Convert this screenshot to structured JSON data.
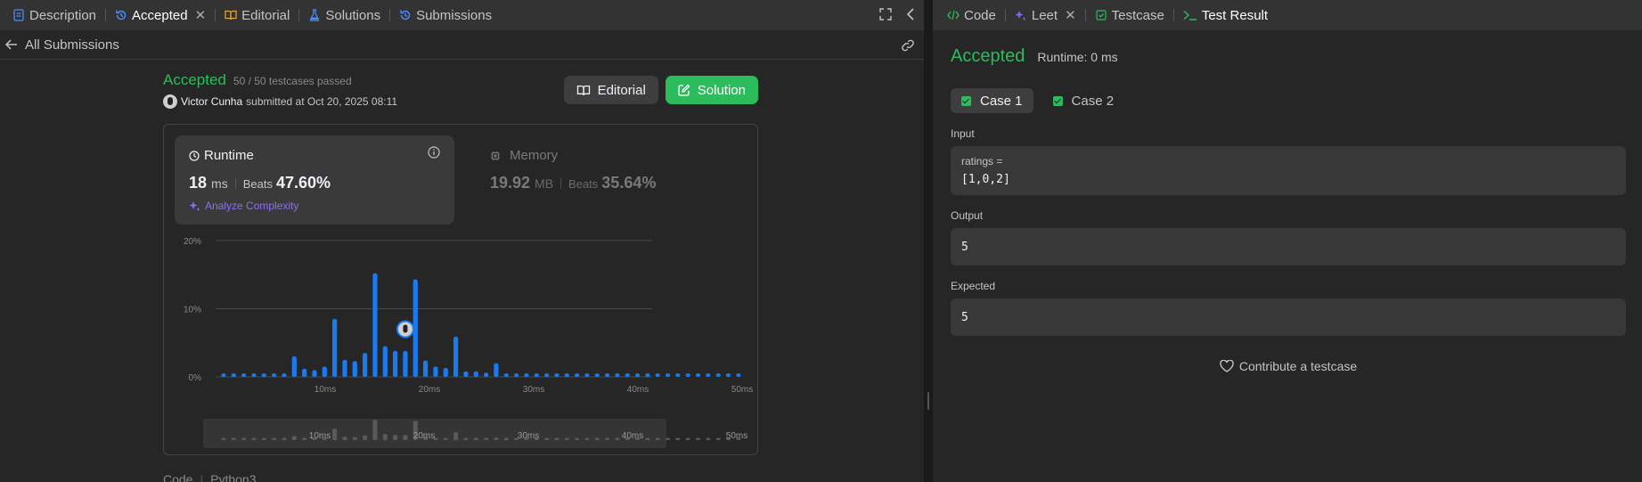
{
  "left_tabs": [
    {
      "label": "Description",
      "icon": "description-icon",
      "color": "#4a8cff"
    },
    {
      "label": "Accepted",
      "icon": "history-icon",
      "color": "#4a8cff",
      "active": true,
      "closable": true
    },
    {
      "label": "Editorial",
      "icon": "book-icon",
      "color": "#e8a835"
    },
    {
      "label": "Solutions",
      "icon": "flask-icon",
      "color": "#4a8cff"
    },
    {
      "label": "Submissions",
      "icon": "history-icon",
      "color": "#4a8cff"
    }
  ],
  "subbar": {
    "back_label": "All Submissions"
  },
  "submission": {
    "status": "Accepted",
    "testcases": "50 / 50 testcases passed",
    "user": "Victor Cunha",
    "submitted_text": "submitted at Oct 20, 2025 08:11",
    "editorial_btn": "Editorial",
    "solution_btn": "Solution"
  },
  "runtime": {
    "title": "Runtime",
    "value": "18",
    "unit": "ms",
    "beats_label": "Beats",
    "beats": "47.60%",
    "analyze": "Analyze Complexity"
  },
  "memory": {
    "title": "Memory",
    "value": "19.92",
    "unit": "MB",
    "beats_label": "Beats",
    "beats": "35.64%"
  },
  "chart_data": {
    "type": "bar",
    "y_ticks": [
      "20%",
      "10%",
      "0%"
    ],
    "ylim": [
      0,
      20
    ],
    "x_ticks": [
      "10ms",
      "20ms",
      "30ms",
      "40ms",
      "50ms"
    ],
    "x_tick_values": [
      10,
      20,
      30,
      40,
      50
    ],
    "x": [
      0,
      1,
      2,
      3,
      4,
      5,
      6,
      7,
      8,
      9,
      10,
      11,
      12,
      13,
      14,
      15,
      16,
      17,
      18,
      19,
      20,
      21,
      22,
      23,
      24,
      25,
      26,
      27,
      28,
      29,
      30,
      31,
      32,
      33,
      34,
      35,
      36,
      37,
      38,
      39,
      40,
      41,
      42,
      43,
      44,
      45,
      46,
      47,
      48,
      49,
      50,
      51
    ],
    "values": [
      0.5,
      0.5,
      0.5,
      0.5,
      0.5,
      0.5,
      0.5,
      3.0,
      1.2,
      1.0,
      1.5,
      8.5,
      2.5,
      2.3,
      3.5,
      15.2,
      4.5,
      3.8,
      3.8,
      14.3,
      2.4,
      1.5,
      1.3,
      5.9,
      0.8,
      0.8,
      0.6,
      2.0,
      0.5,
      0.5,
      0.5,
      0.5,
      0.5,
      0.5,
      0.5,
      0.5,
      0.5,
      0.5,
      0.5,
      0.5,
      0.5,
      0.5,
      0.5,
      0.5,
      0.5,
      0.5,
      0.5,
      0.5,
      0.5,
      0.5,
      0.5,
      0.5
    ],
    "highlight_index": 18,
    "bar_color": "#1a7bf0",
    "nav_bar_color": "#5a5a5a"
  },
  "code_row": {
    "label": "Code",
    "lang": "Python3"
  },
  "right_tabs": [
    {
      "label": "Code",
      "icon": "code-icon",
      "color": "#2cbb5d"
    },
    {
      "label": "Leet",
      "icon": "sparkle-icon",
      "color": "#7a6df0",
      "closable": true
    },
    {
      "label": "Testcase",
      "icon": "checkbox-icon",
      "color": "#2cbb5d"
    },
    {
      "label": "Test Result",
      "icon": "terminal-icon",
      "color": "#2cbb5d",
      "active": true
    }
  ],
  "result": {
    "status": "Accepted",
    "runtime": "Runtime: 0 ms",
    "cases": [
      "Case 1",
      "Case 2"
    ],
    "input_label": "Input",
    "input_var": "ratings =",
    "input_val": "[1,0,2]",
    "output_label": "Output",
    "output_val": "5",
    "expected_label": "Expected",
    "expected_val": "5",
    "contribute": "Contribute a testcase"
  }
}
